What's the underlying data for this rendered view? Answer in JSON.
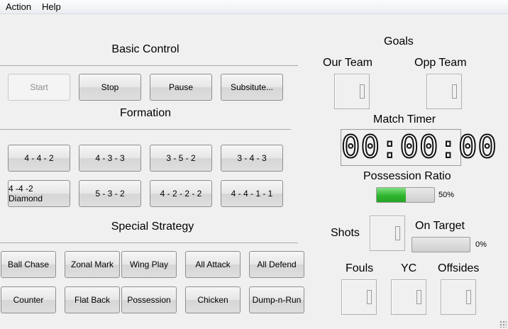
{
  "menu": {
    "items": [
      "Action",
      "Help"
    ]
  },
  "basic_control": {
    "title": "Basic Control",
    "buttons": [
      "Start",
      "Stop",
      "Pause",
      "Subsitute..."
    ]
  },
  "formation": {
    "title": "Formation",
    "buttons": [
      "4 - 4 - 2",
      "4 - 3 - 3",
      "3 - 5 - 2",
      "3 - 4 - 3",
      "4 -4 -2 Diamond",
      "5 - 3 - 2",
      "4 - 2 - 2 - 2",
      "4 - 4 - 1 - 1"
    ]
  },
  "special_strategy": {
    "title": "Special Strategy",
    "buttons": [
      "Ball Chase",
      "Zonal Mark",
      "Wing Play",
      "All Attack",
      "All Defend",
      "Counter",
      "Flat Back",
      "Possession",
      "Chicken",
      "Dump-n-Run"
    ]
  },
  "stats": {
    "goals_title": "Goals",
    "our_team_label": "Our Team",
    "opp_team_label": "Opp Team",
    "match_timer_label": "Match Timer",
    "match_timer_value": "00:00:00",
    "possession_label": "Possession Ratio",
    "possession_value": 0.5,
    "possession_text": "50%",
    "shots_label": "Shots",
    "on_target_label": "On Target",
    "on_target_value": 0,
    "on_target_text": "0%",
    "fouls_label": "Fouls",
    "yc_label": "YC",
    "offsides_label": "Offsides",
    "accent_green": "#2fb52f"
  }
}
